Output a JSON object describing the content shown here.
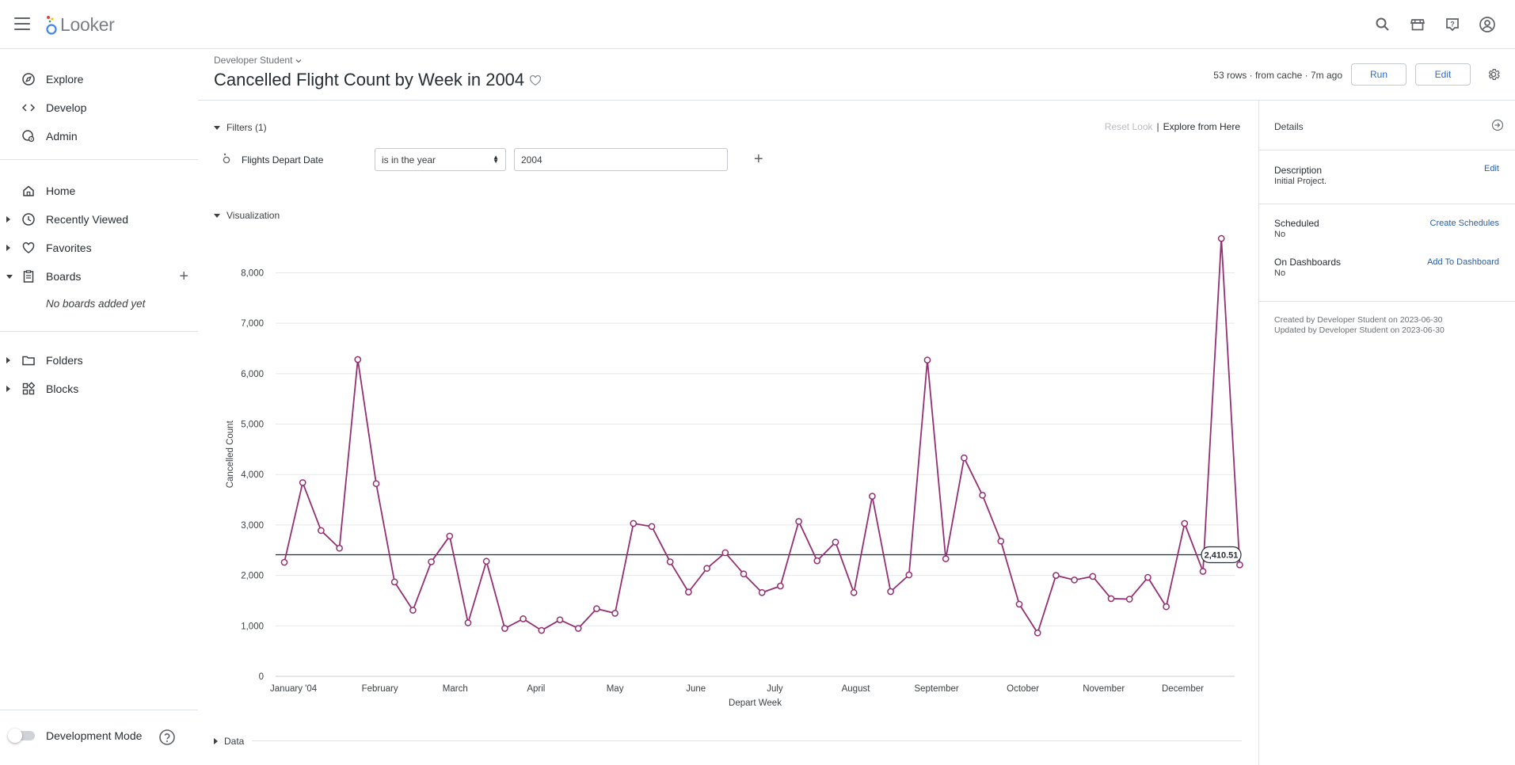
{
  "app": {
    "name": "Looker"
  },
  "sidebar": {
    "primary": [
      {
        "label": "Explore",
        "icon": "compass-icon"
      },
      {
        "label": "Develop",
        "icon": "code-icon"
      },
      {
        "label": "Admin",
        "icon": "admin-gear-icon"
      }
    ],
    "secondary": [
      {
        "label": "Home",
        "icon": "home-icon"
      },
      {
        "label": "Recently Viewed",
        "icon": "clock-icon"
      },
      {
        "label": "Favorites",
        "icon": "heart-icon"
      },
      {
        "label": "Boards",
        "icon": "board-icon"
      }
    ],
    "no_boards": "No boards added yet",
    "tertiary": [
      {
        "label": "Folders",
        "icon": "folder-icon"
      },
      {
        "label": "Blocks",
        "icon": "blocks-icon"
      }
    ],
    "dev_mode_label": "Development Mode"
  },
  "header": {
    "breadcrumb": "Developer Student",
    "title": "Cancelled Flight Count by Week in 2004",
    "rows_info": "53 rows · from cache · 7m ago",
    "run_label": "Run",
    "edit_label": "Edit"
  },
  "filters": {
    "section_label": "Filters (1)",
    "reset_look": "Reset Look",
    "separator": "|",
    "explore_here": "Explore from Here",
    "field_prefix": "Flights",
    "field_name": "Depart Date",
    "operator": "is in the year",
    "value": "2004"
  },
  "visualization": {
    "section_label": "Visualization"
  },
  "data_section": {
    "label": "Data"
  },
  "details": {
    "title": "Details",
    "description_label": "Description",
    "description_edit": "Edit",
    "description_value": "Initial Project.",
    "scheduled_label": "Scheduled",
    "scheduled_link": "Create Schedules",
    "scheduled_value": "No",
    "dashboards_label": "On Dashboards",
    "dashboards_link": "Add To Dashboard",
    "dashboards_value": "No",
    "created": "Created by Developer Student on 2023-06-30",
    "updated": "Updated by Developer Student on 2023-06-30"
  },
  "colors": {
    "series": "#952f73",
    "accent": "#2a6ccf",
    "link": "#2a5da8"
  },
  "chart_data": {
    "type": "line",
    "xlabel": "Depart Week",
    "ylabel": "Cancelled Count",
    "ylim": [
      0,
      8800
    ],
    "yticks": [
      0,
      1000,
      2000,
      3000,
      4000,
      5000,
      6000,
      7000,
      8000
    ],
    "ytick_labels": [
      "0",
      "1,000",
      "2,000",
      "3,000",
      "4,000",
      "5,000",
      "6,000",
      "7,000",
      "8,000"
    ],
    "x_tick_labels": [
      {
        "label": "January '04",
        "week": 0.5
      },
      {
        "label": "February",
        "week": 5.2
      },
      {
        "label": "March",
        "week": 9.3
      },
      {
        "label": "April",
        "week": 13.7
      },
      {
        "label": "May",
        "week": 18
      },
      {
        "label": "June",
        "week": 22.4
      },
      {
        "label": "July",
        "week": 26.7
      },
      {
        "label": "August",
        "week": 31.1
      },
      {
        "label": "September",
        "week": 35.5
      },
      {
        "label": "October",
        "week": 40.2
      },
      {
        "label": "November",
        "week": 44.6
      },
      {
        "label": "December",
        "week": 48.9
      }
    ],
    "reference_line": {
      "value": 2410.51,
      "label": "2,410.51"
    },
    "series": [
      {
        "values": [
          2260,
          3840,
          2890,
          2540,
          6280,
          3820,
          1870,
          1310,
          2270,
          2780,
          1060,
          2280,
          950,
          1140,
          910,
          1120,
          950,
          1340,
          1250,
          3030,
          2970,
          2270,
          1670,
          2140,
          2450,
          2030,
          1660,
          1790,
          3070,
          2290,
          2660,
          1660,
          3570,
          1680,
          2010,
          6270,
          2330,
          4330,
          3590,
          2680,
          1430,
          860,
          2000,
          1910,
          1980,
          1540,
          1530,
          1960,
          1380,
          3030,
          2080,
          8680,
          2210
        ]
      }
    ]
  }
}
